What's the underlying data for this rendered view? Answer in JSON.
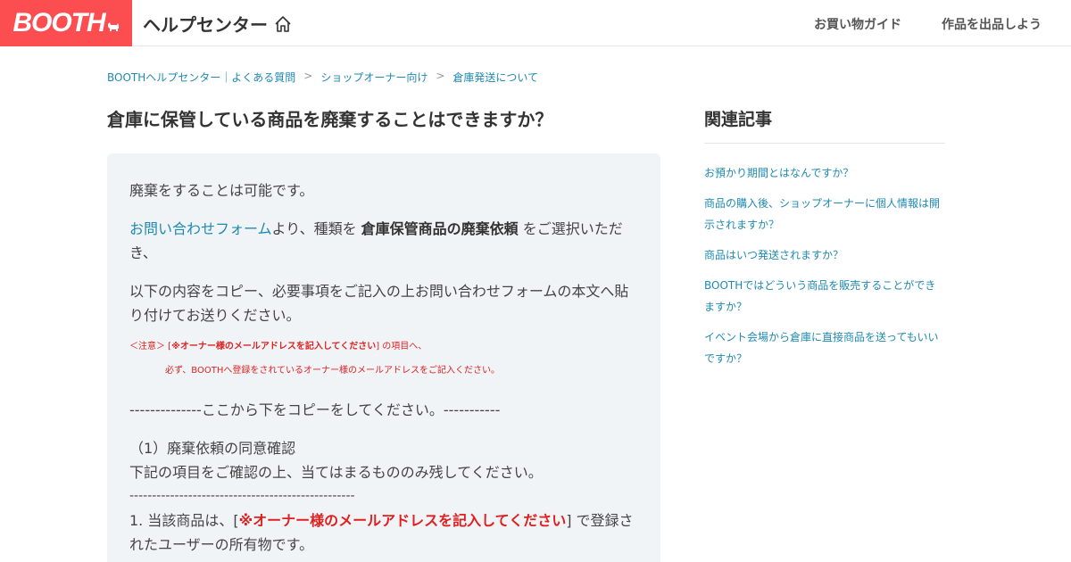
{
  "header": {
    "logo": "BOOTH",
    "help_center_title": "ヘルプセンター",
    "nav": {
      "shopping_guide": "お買い物ガイド",
      "start_selling": "作品を出品しよう"
    }
  },
  "breadcrumb": {
    "items": [
      "BOOTHヘルプセンター｜よくある質問",
      "ショップオーナー向け",
      "倉庫発送について"
    ],
    "separator": ">"
  },
  "article": {
    "title": "倉庫に保管している商品を廃棄することはできますか？",
    "p1": "廃棄をすることは可能です。",
    "p2_link": "お問い合わせフォーム",
    "p2_text1": "より、種類を ",
    "p2_bold": "倉庫保管商品の廃棄依頼",
    "p2_text2": " をご選択いただき、",
    "p3": "以下の内容をコピー、必要事項をご記入の上お問い合わせフォームの本文へ貼り付けてお送りください。",
    "note_prefix": "＜注意＞ [",
    "note_bold": "※オーナー様のメールアドレスを記入してください",
    "note_suffix": "] の項目へ、",
    "note_line2": "必ず、BOOTHへ登録をされているオーナー様のメールアドレスをご記入ください。",
    "copy_marker": "--------------ここから下をコピーをしてください。-----------",
    "section1_title": "（1）廃棄依頼の同意確認",
    "section1_desc": "下記の項目をご確認の上、当てはまるもののみ残してください。",
    "divider": "--------------------------------------------------",
    "item1_prefix": "1. 当該商品は、[",
    "item1_red": "※オーナー様のメールアドレスを記入してください",
    "item1_suffix": "] で登録されたユーザーの所有物です。"
  },
  "sidebar": {
    "title": "関連記事",
    "links": [
      "お預かり期間とはなんですか？",
      "商品の購入後、ショップオーナーに個人情報は開示されますか？",
      "商品はいつ発送されますか？",
      "BOOTHではどういう商品を販売することができますか？",
      "イベント会場から倉庫に直接商品を送ってもいいですか？"
    ]
  },
  "colors": {
    "brand": "#fc4d50",
    "link": "#1f8ab0",
    "warning": "#e02020",
    "content_bg": "#f0f4f7"
  },
  "icons": {
    "home": "home-icon",
    "logo_mascot": "dog-icon"
  }
}
